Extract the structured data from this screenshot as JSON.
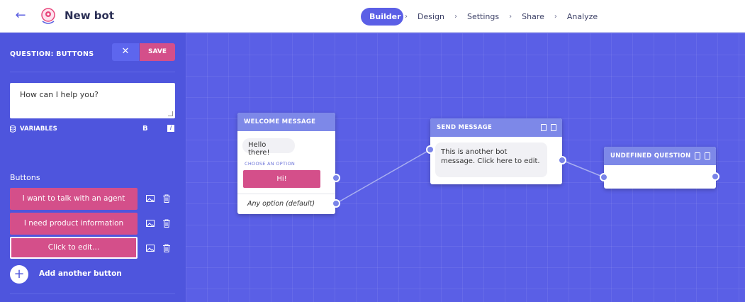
{
  "header": {
    "back_icon": "arrow-left-icon",
    "logo_icon": "bot-logo-icon",
    "bot_name": "New bot",
    "steps": [
      "Builder",
      "Design",
      "Settings",
      "Share",
      "Analyze"
    ],
    "active_step": "Builder",
    "separator_icon": "chevron-right-icon"
  },
  "panel": {
    "title": "QUESTION: BUTTONS",
    "close_icon": "close-icon",
    "save_label": "SAVE",
    "question_text": "How can I help you?",
    "variables_label": "VARIABLES",
    "bold_label": "B",
    "italic_label": "I",
    "buttons_heading": "Buttons",
    "buttons": [
      {
        "label": "I want to talk with an agent"
      },
      {
        "label": "I need product information"
      },
      {
        "label": "Click to edit..."
      }
    ],
    "add_label": "Add another button",
    "add_icon": "plus-icon"
  },
  "nodes": {
    "welcome": {
      "title": "WELCOME MESSAGE",
      "message": "Hello there!",
      "choose_label": "CHOOSE AN OPTION",
      "option_label": "Hi!",
      "default_label": "Any option (default)"
    },
    "send": {
      "title": "SEND MESSAGE",
      "message": "This is another bot message. Click here to edit."
    },
    "undefined": {
      "title": "UNDEFINED QUESTION"
    }
  },
  "colors": {
    "accent": "#5a5fe6",
    "panel": "#4e55dd",
    "pink": "#d44f8a",
    "node_header": "#7d88e8"
  }
}
